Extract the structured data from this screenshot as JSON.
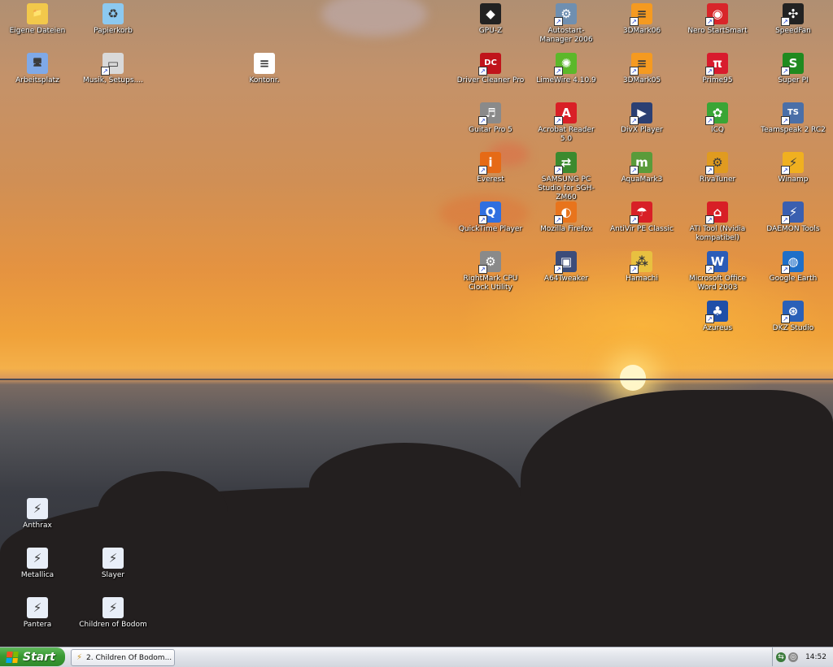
{
  "desktop": {
    "icons": [
      {
        "label": "Eigene Dateien",
        "icon": "folder-icon",
        "glyph": "📁",
        "color": "#f2c84b",
        "shortcut": false
      },
      {
        "label": "Papierkorb",
        "icon": "recycle-bin-icon",
        "glyph": "♻",
        "color": "#8cc9f0",
        "shortcut": false
      },
      {
        "label": "Arbeitsplatz",
        "icon": "computer-icon",
        "glyph": "🖥",
        "color": "#7fa9e8",
        "shortcut": false
      },
      {
        "label": "Musik, Setups....",
        "icon": "network-drive-icon",
        "glyph": "▭",
        "color": "#d9d9d9",
        "shortcut": true
      },
      {
        "label": "Kontonr.",
        "icon": "text-document-icon",
        "glyph": "≡",
        "color": "#ffffff",
        "shortcut": false
      },
      {
        "label": "GPU-Z",
        "icon": "gpu-chip-icon",
        "glyph": "◆",
        "color": "#222222",
        "shortcut": false
      },
      {
        "label": "Autostart-Manager 2006",
        "icon": "autostart-icon",
        "glyph": "⚙",
        "color": "#6f8fb0",
        "shortcut": true
      },
      {
        "label": "3DMark06",
        "icon": "3dmark-icon",
        "glyph": "≡",
        "color": "#f59a20",
        "shortcut": true
      },
      {
        "label": "Nero StartSmart",
        "icon": "nero-icon",
        "glyph": "◉",
        "color": "#d8262a",
        "shortcut": true
      },
      {
        "label": "SpeedFan",
        "icon": "fan-icon",
        "glyph": "✣",
        "color": "#222222",
        "shortcut": true
      },
      {
        "label": "Driver Cleaner Pro",
        "icon": "dc-icon",
        "glyph": "DC",
        "color": "#c0141b",
        "shortcut": true
      },
      {
        "label": "LimeWire 4.10.9",
        "icon": "limewire-icon",
        "glyph": "✺",
        "color": "#5cb82a",
        "shortcut": true
      },
      {
        "label": "3DMark05",
        "icon": "3dmark-icon",
        "glyph": "≡",
        "color": "#f59a20",
        "shortcut": true
      },
      {
        "label": "Prime95",
        "icon": "prime95-icon",
        "glyph": "π",
        "color": "#d81b2d",
        "shortcut": true
      },
      {
        "label": "Super PI",
        "icon": "superpi-icon",
        "glyph": "S",
        "color": "#1f8a1f",
        "shortcut": true
      },
      {
        "label": "Guitar Pro 5",
        "icon": "guitar-pro-icon",
        "glyph": "♬",
        "color": "#8a8a8a",
        "shortcut": true
      },
      {
        "label": "Acrobat Reader 5.0",
        "icon": "acrobat-icon",
        "glyph": "A",
        "color": "#d91f26",
        "shortcut": true
      },
      {
        "label": "DivX Player",
        "icon": "divx-icon",
        "glyph": "▶",
        "color": "#2b3f73",
        "shortcut": true
      },
      {
        "label": "ICQ",
        "icon": "icq-flower-icon",
        "glyph": "✿",
        "color": "#3aa535",
        "shortcut": true
      },
      {
        "label": "Teamspeak 2 RC2",
        "icon": "teamspeak-icon",
        "glyph": "TS",
        "color": "#4a6fa8",
        "shortcut": true
      },
      {
        "label": "Everest",
        "icon": "everest-icon",
        "glyph": "i",
        "color": "#e66a16",
        "shortcut": true
      },
      {
        "label": "SAMSUNG PC Studio for SGH-ZM60",
        "icon": "samsung-sync-icon",
        "glyph": "⇄",
        "color": "#3b8a2e",
        "shortcut": true
      },
      {
        "label": "AquaMark3",
        "icon": "aquamark-icon",
        "glyph": "m",
        "color": "#5a9b3a",
        "shortcut": true
      },
      {
        "label": "RivaTuner",
        "icon": "rivatuner-icon",
        "glyph": "⚙",
        "color": "#e09b20",
        "shortcut": true
      },
      {
        "label": "Winamp",
        "icon": "winamp-icon",
        "glyph": "⚡",
        "color": "#f0b020",
        "shortcut": true
      },
      {
        "label": "QuickTime Player",
        "icon": "quicktime-icon",
        "glyph": "Q",
        "color": "#2f6fe0",
        "shortcut": true
      },
      {
        "label": "Mozilla Firefox",
        "icon": "firefox-icon",
        "glyph": "◐",
        "color": "#e8741c",
        "shortcut": true
      },
      {
        "label": "AntiVir PE Classic",
        "icon": "antivir-umbrella-icon",
        "glyph": "☂",
        "color": "#d81f26",
        "shortcut": true
      },
      {
        "label": "ATI Tool (Nvidia kompatibel)",
        "icon": "ati-tool-icon",
        "glyph": "⌂",
        "color": "#d81f26",
        "shortcut": true
      },
      {
        "label": "DAEMON Tools",
        "icon": "daemon-tools-icon",
        "glyph": "⚡",
        "color": "#3a5fb0",
        "shortcut": true
      },
      {
        "label": "RightMark CPU Clock Utility",
        "icon": "rightmark-gear-icon",
        "glyph": "⚙",
        "color": "#8a8a8a",
        "shortcut": true
      },
      {
        "label": "A64Tweaker",
        "icon": "a64tweaker-icon",
        "glyph": "▣",
        "color": "#3b4c7a",
        "shortcut": true
      },
      {
        "label": "Hamachi",
        "icon": "hamachi-icon",
        "glyph": "⁂",
        "color": "#e8c040",
        "shortcut": true
      },
      {
        "label": "Microsoft Office Word 2003",
        "icon": "word-icon",
        "glyph": "W",
        "color": "#2b5cb8",
        "shortcut": true
      },
      {
        "label": "Google Earth",
        "icon": "google-earth-icon",
        "glyph": "◍",
        "color": "#1f6fc8",
        "shortcut": true
      },
      {
        "label": "Azureus",
        "icon": "azureus-frog-icon",
        "glyph": "♣",
        "color": "#1f4fa8",
        "shortcut": true
      },
      {
        "label": "DKZ Studio",
        "icon": "dkz-studio-icon",
        "glyph": "⊛",
        "color": "#2a60b8",
        "shortcut": true
      },
      {
        "label": "Anthrax",
        "icon": "winamp-playlist-file-icon",
        "glyph": "⚡",
        "color": "#e8eef8",
        "shortcut": false
      },
      {
        "label": "Metallica",
        "icon": "winamp-playlist-file-icon",
        "glyph": "⚡",
        "color": "#e8eef8",
        "shortcut": false
      },
      {
        "label": "Slayer",
        "icon": "winamp-playlist-file-icon",
        "glyph": "⚡",
        "color": "#e8eef8",
        "shortcut": false
      },
      {
        "label": "Pantera",
        "icon": "winamp-playlist-file-icon",
        "glyph": "⚡",
        "color": "#e8eef8",
        "shortcut": false
      },
      {
        "label": "Children of Bodom",
        "icon": "winamp-playlist-file-icon",
        "glyph": "⚡",
        "color": "#e8eef8",
        "shortcut": false
      }
    ]
  },
  "taskbar": {
    "start_label": "Start",
    "task_label": "2. Children Of Bodom...",
    "clock": "14:52"
  }
}
